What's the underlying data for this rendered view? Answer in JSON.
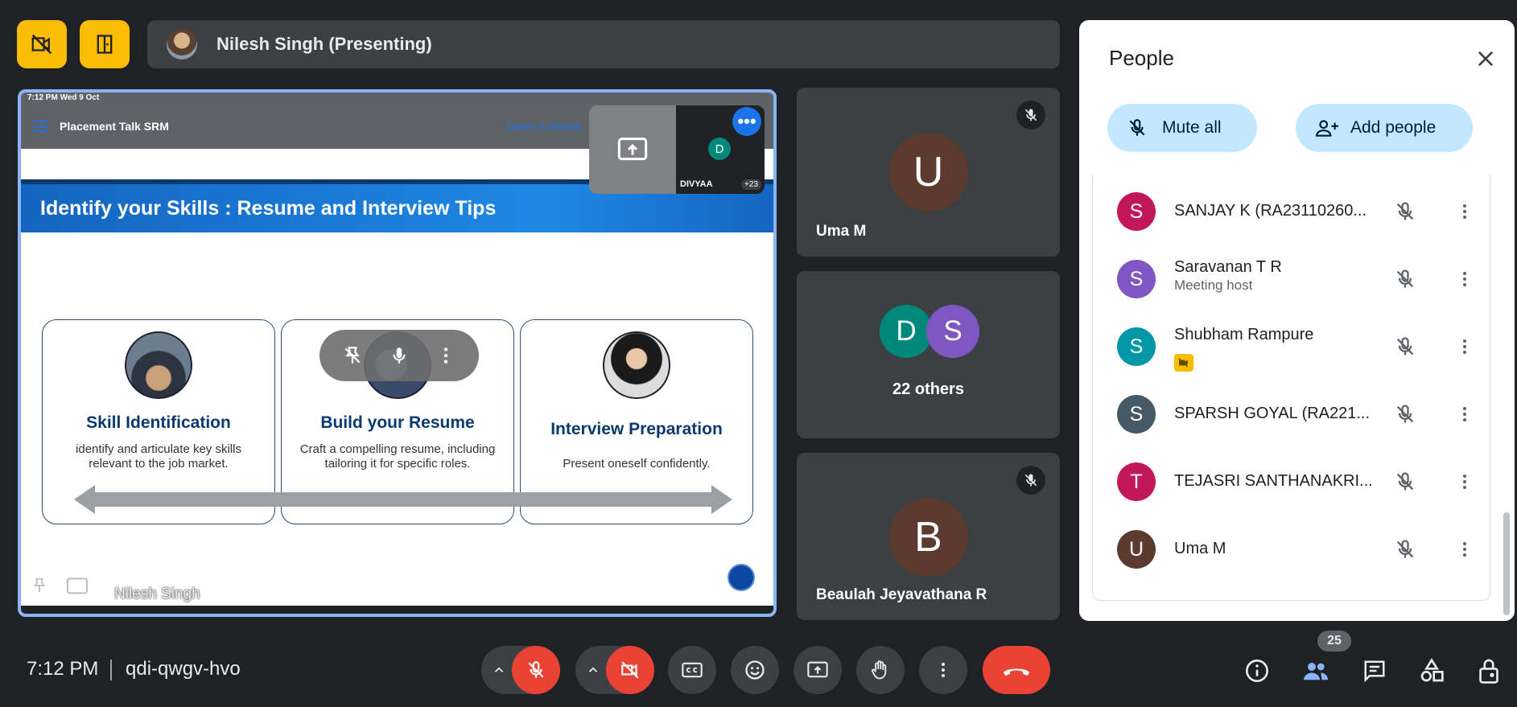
{
  "presenter_bar": {
    "name": "Nilesh Singh (Presenting)"
  },
  "stage": {
    "ipad_status": "7:12 PM  Wed 9 Oct",
    "doc_title": "Placement Talk SRM",
    "open_in_books": "Open in Books",
    "slide_title": "Identify your Skills : Resume and Interview Tips",
    "cards": [
      {
        "title": "Skill Identification",
        "body": "identify and articulate key skills relevant to the job market."
      },
      {
        "title": "Build your Resume",
        "body": "Craft a compelling resume, including tailoring it for specific roles."
      },
      {
        "title": "Interview Preparation",
        "body": "Present oneself confidently."
      }
    ],
    "pip": {
      "avatar_letter": "D",
      "name": "DIVYAA",
      "count": "+23"
    },
    "footer_name": "Nilesh Singh"
  },
  "tiles": {
    "uma": {
      "letter": "U",
      "name": "Uma M",
      "color": "#5d3a2e"
    },
    "others": {
      "letter1": "D",
      "letter2": "S",
      "label": "22 others",
      "color1": "#00897b",
      "color2": "#7e57c2"
    },
    "beaulah": {
      "letter": "B",
      "name": "Beaulah Jeyavathana R",
      "color": "#5d3a2e"
    }
  },
  "people_panel": {
    "title": "People",
    "mute_all": "Mute all",
    "add_people": "Add people",
    "people": [
      {
        "letter": "S",
        "name": "SANJAY K (RA23110260...",
        "sub": "",
        "color": "#c2185b"
      },
      {
        "letter": "S",
        "name": "Saravanan T R",
        "sub": "Meeting host",
        "color": "#7e57c2"
      },
      {
        "letter": "S",
        "name": "Shubham Rampure",
        "sub": "",
        "color": "#0097a7"
      },
      {
        "letter": "S",
        "name": "SPARSH GOYAL (RA221...",
        "sub": "",
        "color": "#455a64"
      },
      {
        "letter": "T",
        "name": "TEJASRI SANTHANAKRI...",
        "sub": "",
        "color": "#c2185b"
      },
      {
        "letter": "U",
        "name": "Uma M",
        "sub": "",
        "color": "#5d3a2e"
      }
    ]
  },
  "bottom_bar": {
    "time": "7:12 PM",
    "meeting_code": "qdi-qwgv-hvo",
    "participant_count": "25"
  },
  "colors": {
    "accent": "#8ab4f8",
    "danger": "#ea4335",
    "warning": "#fbbc04",
    "panel_button": "#c2e7ff"
  }
}
